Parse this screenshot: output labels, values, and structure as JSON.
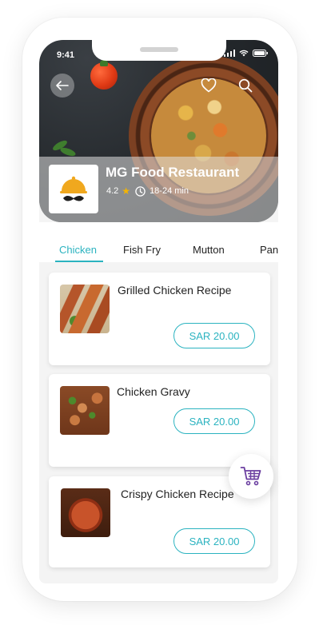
{
  "status_bar": {
    "time": "9:41"
  },
  "restaurant": {
    "name": "MG Food Restaurant",
    "rating": "4.2",
    "delivery_time": "18-24 min"
  },
  "tabs": [
    {
      "label": "Chicken",
      "active": true
    },
    {
      "label": "Fish Fry",
      "active": false
    },
    {
      "label": "Mutton",
      "active": false
    },
    {
      "label": "Pan",
      "active": false
    }
  ],
  "dishes": [
    {
      "name": "Grilled Chicken Recipe",
      "price": "SAR 20.00"
    },
    {
      "name": "Chicken Gravy",
      "price": "SAR 20.00"
    },
    {
      "name": "Crispy Chicken Recipe",
      "price": "SAR 20.00"
    }
  ],
  "colors": {
    "accent": "#2bb3c0",
    "star": "#f4b400",
    "cart_icon": "#6b3fa0"
  },
  "icons": {
    "back": "arrow-left-icon",
    "favorite": "heart-icon",
    "search": "search-icon",
    "rating": "star-icon",
    "time": "clock-icon",
    "cart": "cart-icon"
  }
}
